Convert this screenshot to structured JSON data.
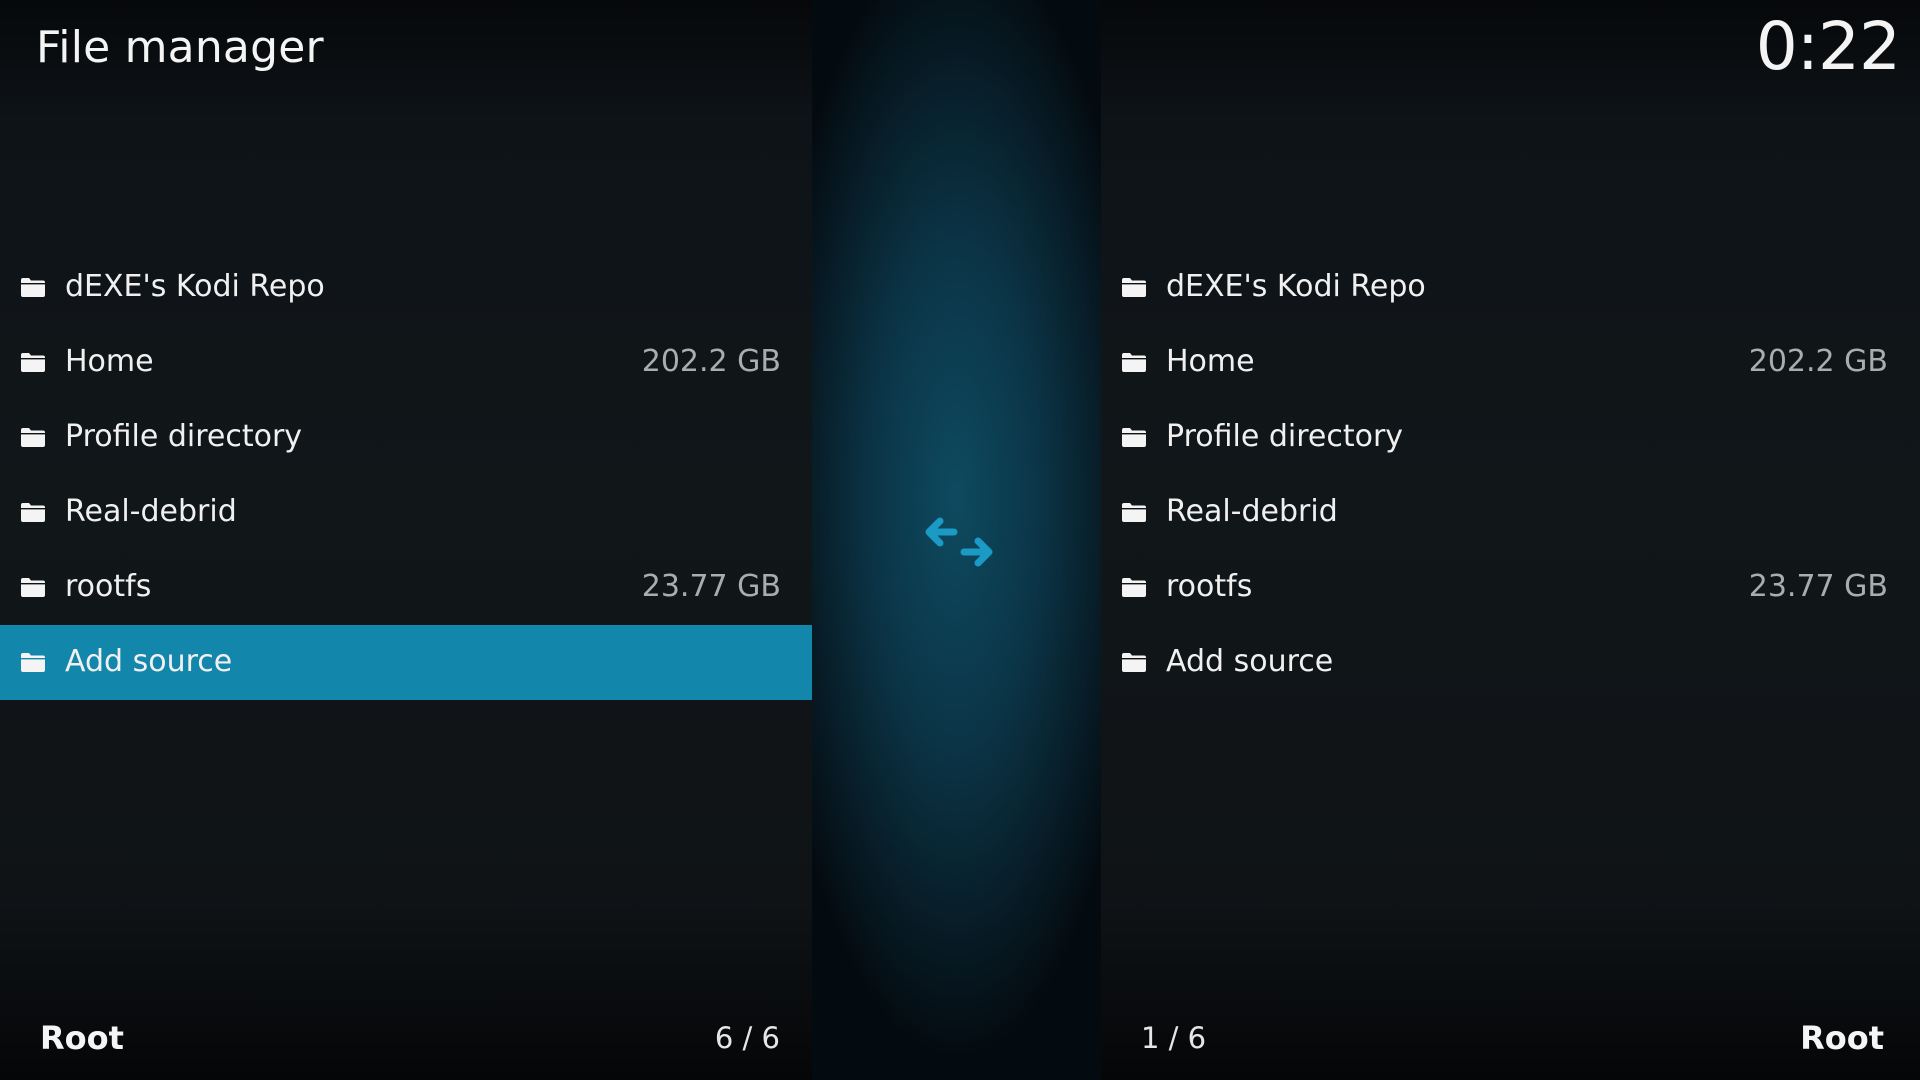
{
  "header": {
    "title": "File manager",
    "clock": "0:22"
  },
  "accent_color": "#1286ab",
  "left_pane": {
    "items": [
      {
        "label": "dEXE's Kodi Repo",
        "size": "",
        "icon": "folder-icon"
      },
      {
        "label": "Home",
        "size": "202.2 GB",
        "icon": "folder-icon"
      },
      {
        "label": "Profile directory",
        "size": "",
        "icon": "folder-icon"
      },
      {
        "label": "Real-debrid",
        "size": "",
        "icon": "folder-icon"
      },
      {
        "label": "rootfs",
        "size": "23.77 GB",
        "icon": "folder-icon"
      },
      {
        "label": "Add source",
        "size": "",
        "icon": "folder-icon",
        "focused": true
      }
    ],
    "footer_path": "Root",
    "footer_count": "6 / 6"
  },
  "center": {
    "icon": "swap-arrows-icon"
  },
  "right_pane": {
    "items": [
      {
        "label": "dEXE's Kodi Repo",
        "size": "",
        "icon": "folder-icon"
      },
      {
        "label": "Home",
        "size": "202.2 GB",
        "icon": "folder-icon"
      },
      {
        "label": "Profile directory",
        "size": "",
        "icon": "folder-icon"
      },
      {
        "label": "Real-debrid",
        "size": "",
        "icon": "folder-icon"
      },
      {
        "label": "rootfs",
        "size": "23.77 GB",
        "icon": "folder-icon"
      },
      {
        "label": "Add source",
        "size": "",
        "icon": "folder-icon"
      }
    ],
    "footer_path": "Root",
    "footer_count": "1 / 6"
  }
}
